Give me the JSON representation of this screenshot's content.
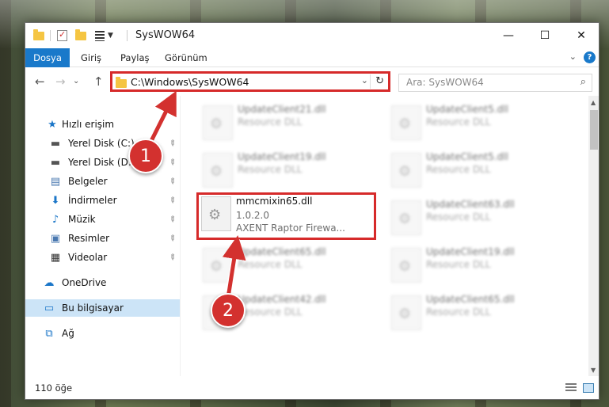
{
  "window": {
    "title": "SysWOW64"
  },
  "window_controls": {
    "minimize": "—",
    "maximize": "☐",
    "close": "✕"
  },
  "ribbon": {
    "file_tab": "Dosya",
    "tabs": [
      "Giriş",
      "Paylaş",
      "Görünüm"
    ],
    "collapse": "⌄",
    "help": "?"
  },
  "address_bar": {
    "path": "C:\\Windows\\SysWOW64",
    "dropdown": "⌄",
    "refresh": "↻"
  },
  "search": {
    "placeholder": "Ara: SysWOW64",
    "icon": "⌕"
  },
  "nav_buttons": {
    "back": "←",
    "forward": "→",
    "recent": "⌄",
    "up": "↑"
  },
  "sidebar": {
    "items": [
      {
        "label": "Hızlı erişim",
        "icon": "star-icon",
        "glyph": "★",
        "color": "#1b76c8"
      },
      {
        "label": "Yerel Disk (C:)",
        "icon": "drive-icon",
        "glyph": "▬",
        "color": "#555555",
        "pinned": true
      },
      {
        "label": "Yerel Disk (D:)",
        "icon": "drive-icon",
        "glyph": "▬",
        "color": "#555555",
        "pinned": true
      },
      {
        "label": "Belgeler",
        "icon": "documents-icon",
        "glyph": "▤",
        "color": "#4a78b0",
        "pinned": true
      },
      {
        "label": "İndirmeler",
        "icon": "downloads-icon",
        "glyph": "⬇",
        "color": "#1b76c8",
        "pinned": true
      },
      {
        "label": "Müzik",
        "icon": "music-icon",
        "glyph": "♪",
        "color": "#1b76c8",
        "pinned": true
      },
      {
        "label": "Resimler",
        "icon": "pictures-icon",
        "glyph": "▣",
        "color": "#4a78b0",
        "pinned": true
      },
      {
        "label": "Videolar",
        "icon": "videos-icon",
        "glyph": "▦",
        "color": "#333333",
        "pinned": true
      },
      {
        "label": "OneDrive",
        "icon": "cloud-icon",
        "glyph": "☁",
        "color": "#1b76c8"
      },
      {
        "label": "Bu bilgisayar",
        "icon": "computer-icon",
        "glyph": "▭",
        "color": "#1b76c8"
      },
      {
        "label": "Ağ",
        "icon": "network-icon",
        "glyph": "⧉",
        "color": "#1b76c8"
      }
    ],
    "pin_glyph": "📌"
  },
  "files": [
    {
      "name": "UpdateClient21.dll",
      "type": "Resource DLL"
    },
    {
      "name": "UpdateClient5.dll",
      "type": "Resource DLL"
    },
    {
      "name": "UpdateClient19.dll",
      "type": "Resource DLL"
    },
    {
      "name": "UpdateClient5.dll",
      "type": "Resource DLL"
    },
    {
      "name": "mmcmixin65.dll",
      "version": "1.0.2.0",
      "description": "AXENT Raptor Firewa..."
    },
    {
      "name": "UpdateClient63.dll",
      "type": "Resource DLL"
    },
    {
      "name": "UpdateClient65.dll",
      "type": "Resource DLL"
    },
    {
      "name": "UpdateClient19.dll",
      "type": "Resource DLL"
    },
    {
      "name": "UpdateClient42.dll",
      "type": "Resource DLL"
    },
    {
      "name": "UpdateClient65.dll",
      "type": "Resource DLL"
    }
  ],
  "status": {
    "item_count": "110 öğe"
  },
  "callouts": [
    {
      "number": "1"
    },
    {
      "number": "2"
    }
  ],
  "colors": {
    "accent": "#1979ca",
    "highlight_red": "#d62a2a",
    "badge_red": "#d3312f",
    "selection": "#cce4f7"
  }
}
